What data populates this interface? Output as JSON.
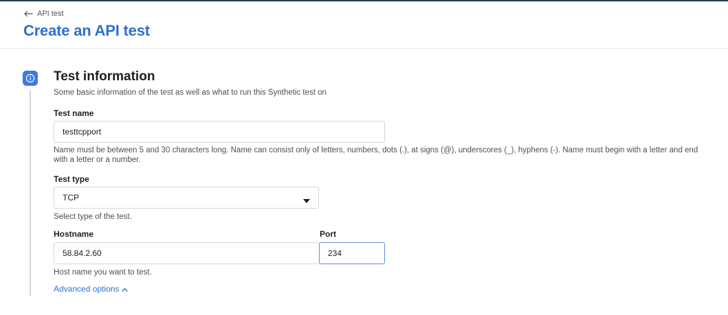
{
  "header": {
    "breadcrumb_label": "API test",
    "title": "Create an API test"
  },
  "section": {
    "title": "Test information",
    "description": "Some basic information of the test as well as what to run this Synthetic test on"
  },
  "fields": {
    "test_name": {
      "label": "Test name",
      "value": "testtcpport",
      "help": "Name must be between 5 and 30 characters long. Name can consist only of letters, numbers, dots (.), at signs (@), underscores (_), hyphens (-). Name must begin with a letter and end with a letter or a number."
    },
    "test_type": {
      "label": "Test type",
      "value": "TCP",
      "help": "Select type of the test."
    },
    "hostname": {
      "label": "Hostname",
      "value": "58.84.2.60",
      "help": "Host name you want to test."
    },
    "port": {
      "label": "Port",
      "value": "234"
    }
  },
  "advanced_options_label": "Advanced options",
  "colors": {
    "accent": "#2f6fd1",
    "badge": "#3b7be0",
    "border": "#d3d6da",
    "focus_border": "#5b8ee6"
  },
  "icons": {
    "back": "arrow-left-icon",
    "step": "info-icon",
    "select": "caret-down-icon",
    "advanced": "chevron-up-icon"
  }
}
